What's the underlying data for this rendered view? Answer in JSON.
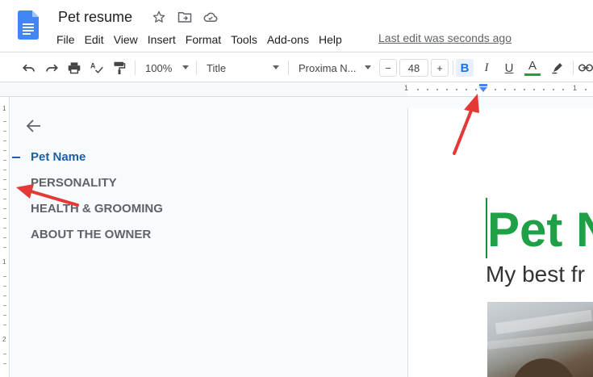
{
  "app": {
    "doc_title": "Pet resume",
    "menu": [
      "File",
      "Edit",
      "View",
      "Insert",
      "Format",
      "Tools",
      "Add-ons",
      "Help"
    ],
    "last_edit": "Last edit was seconds ago"
  },
  "toolbar": {
    "zoom": "100%",
    "style": "Title",
    "font": "Proxima N...",
    "font_size_minus": "−",
    "font_size": "48",
    "font_size_plus": "+",
    "bold": "B",
    "italic": "I",
    "underline": "U",
    "text_color": "A"
  },
  "ruler": {
    "labels": [
      "1",
      "1"
    ]
  },
  "vruler": {
    "labels": [
      "1",
      "1",
      "2"
    ]
  },
  "outline": {
    "items": [
      "Pet Name",
      "PERSONALITY",
      "HEALTH & GROOMING",
      "ABOUT THE OWNER"
    ]
  },
  "document": {
    "title": "Pet N",
    "subtitle": "My best fr"
  },
  "colors": {
    "accent_blue": "#1a73e8",
    "title_green": "#1fa046",
    "annotation_red": "#e53935"
  }
}
